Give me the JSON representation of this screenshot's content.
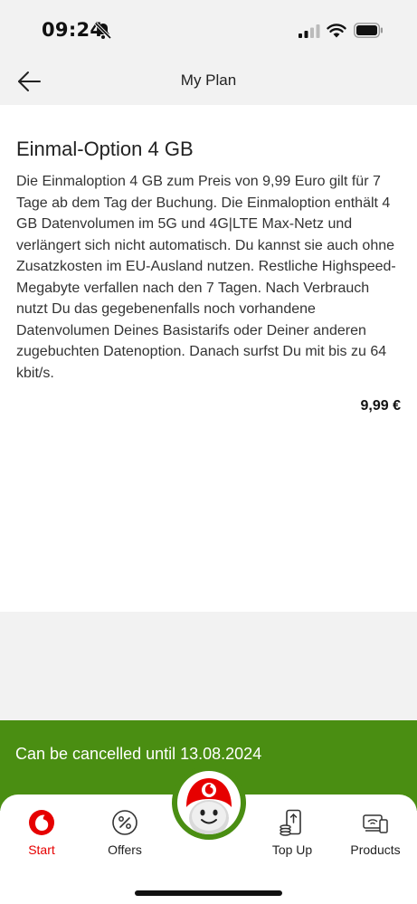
{
  "status_bar": {
    "time": "09:24"
  },
  "header": {
    "title": "My Plan"
  },
  "option": {
    "title": "Einmal-Option 4 GB",
    "description": "Die Einmaloption 4 GB zum Preis von 9,99 Euro gilt für 7 Tage ab dem Tag der Buchung. Die Einmaloption enthält 4 GB Datenvolumen im 5G und 4G|LTE Max-Netz und verlängert sich nicht automatisch. Du kannst sie auch ohne Zusatzkosten im EU-Ausland nutzen. Restliche Highspeed- Megabyte verfallen nach den 7 Tagen. Nach Verbrauch nutzt Du das gegebenenfalls noch vorhandene Datenvolumen Deines Basistarifs oder Deiner anderen zugebuchten Datenoption. Danach surfst Du mit bis zu 64 kbit/s.",
    "price": "9,99 €"
  },
  "banner": {
    "text": "Can be cancelled until 13.08.2024"
  },
  "tabs": [
    {
      "label": "Start",
      "icon": "vodafone-logo-icon",
      "active": true
    },
    {
      "label": "Offers",
      "icon": "percent-icon",
      "active": false
    },
    {
      "label": "Top Up",
      "icon": "phone-top-up-icon",
      "active": false
    },
    {
      "label": "Products",
      "icon": "devices-icon",
      "active": false
    }
  ],
  "colors": {
    "brand_red": "#e60000",
    "banner_green": "#4a8e12"
  }
}
